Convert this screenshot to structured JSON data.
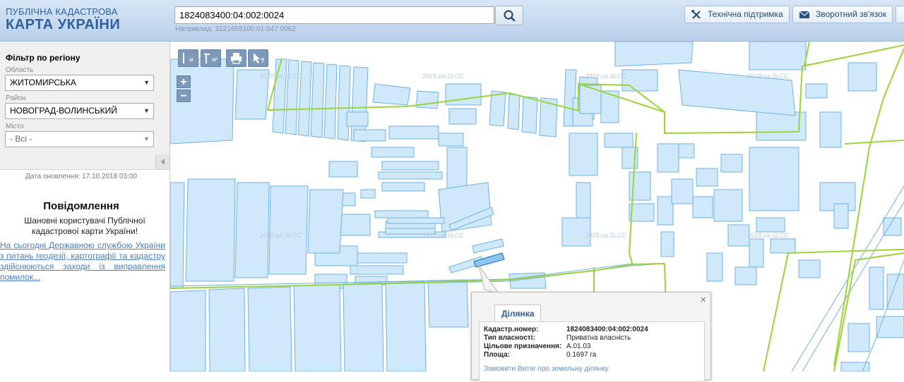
{
  "header": {
    "logo_line1": "ПУБЛІЧНА КАДАСТРОВА",
    "logo_line2": "КАРТА УКРАЇНИ",
    "search_value": "1824083400:04:002:0024",
    "example": "Наприклад: 3221655100:01:047:0062",
    "support_label": "Технічна підтримка",
    "feedback_label": "Зворотний зв'язок"
  },
  "filter": {
    "title": "Фільтр по регіону",
    "oblast_label": "Область",
    "oblast_value": "ЖИТОМИРСЬКА",
    "rayon_label": "Район",
    "rayon_value": "НОВОГРАД-ВОЛИНСЬКИЙ",
    "misto_label": "Місто",
    "misto_value": "- Всі -"
  },
  "sidebar": {
    "update_date": "Дата оновлення: 17.10.2018 03:00",
    "notice_title": "Повідомлення",
    "notice_greeting": "Шановні користувачі Публічної кадастрової карти України!",
    "notice_link": "На сьогодні Державною службою України з питань геодезії, картографії та кадастру здійснюються заходи із виправлення помилок..."
  },
  "map": {
    "watermark": "2018.ua.SLCC",
    "zoom_in": "+",
    "zoom_out": "−",
    "tool_ruler_label": "м",
    "tool_area_label": "м²"
  },
  "popup": {
    "tab_label": "Ділянка",
    "close_label": "×",
    "rows": [
      {
        "key": "Кадастр.номер:",
        "value": "1824083400:04:002:0024"
      },
      {
        "key": "Тип власності:",
        "value": "Приватна власність"
      },
      {
        "key": "Цільове призначення:",
        "value": "A.01.03"
      },
      {
        "key": "Площа:",
        "value": "0.1697 га"
      }
    ],
    "order_link": "Замовити Витяг про земельну ділянку"
  },
  "colors": {
    "parcel_fill": "#cfe9fb",
    "parcel_stroke": "#6fb1e2",
    "boundary": "#9cd33a",
    "header_text": "#2f5f9e",
    "tool_bg": "#7d99b9"
  }
}
